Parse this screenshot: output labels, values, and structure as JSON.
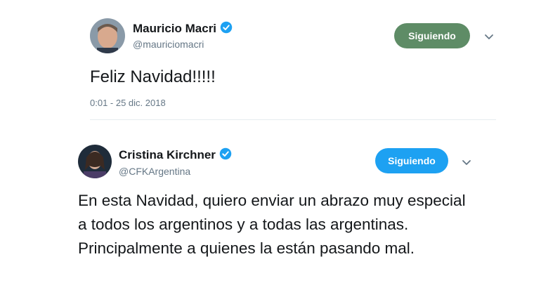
{
  "tweets": [
    {
      "name": "Mauricio Macri",
      "handle": "@mauriciomacri",
      "follow_label": "Siguiendo",
      "text": "Feliz Navidad!!!!!",
      "timestamp": "0:01 - 25 dic. 2018"
    },
    {
      "name": "Cristina Kirchner",
      "handle": "@CFKArgentina",
      "follow_label": "Siguiendo",
      "text": "En esta Navidad, quiero enviar un abrazo muy especial a todos los argentinos y a todas las argentinas. Principalmente a quienes la están pasando mal."
    }
  ],
  "colors": {
    "following_button_macri": "#5e8c66",
    "following_button_cfk": "#1da1f2",
    "verified_badge": "#1da1f2",
    "handle_gray": "#657786"
  },
  "icons": {
    "verified": "verified-badge-icon",
    "dropdown": "chevron-down-icon"
  }
}
